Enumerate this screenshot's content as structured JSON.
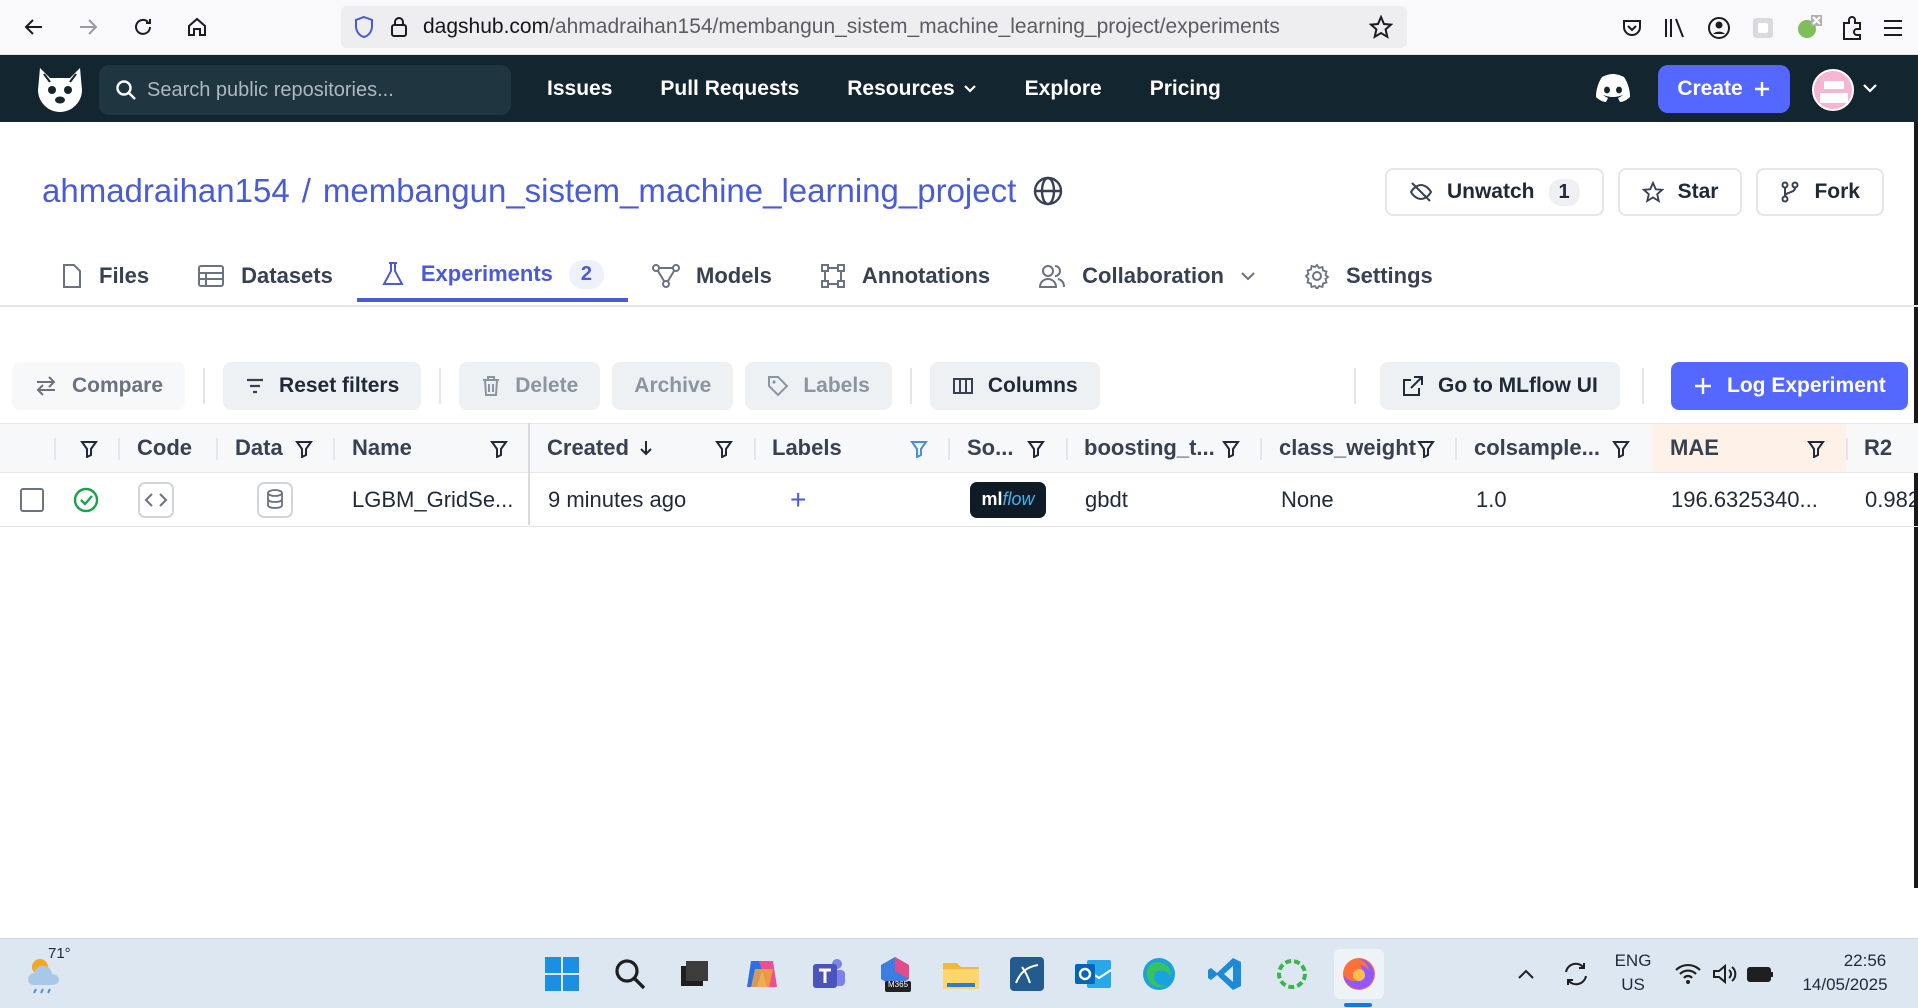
{
  "browser": {
    "url_domain": "dagshub.com",
    "url_path": "/ahmadraihan154/membangun_sistem_machine_learning_project/experiments"
  },
  "header": {
    "search_placeholder": "Search public repositories...",
    "nav": [
      "Issues",
      "Pull Requests",
      "Resources",
      "Explore",
      "Pricing"
    ],
    "create_label": "Create"
  },
  "repo": {
    "owner": "ahmadraihan154",
    "slash": "/",
    "name": "membangun_sistem_machine_learning_project",
    "unwatch_label": "Unwatch",
    "watch_count": "1",
    "star_label": "Star",
    "fork_label": "Fork"
  },
  "tabs": [
    {
      "label": "Files"
    },
    {
      "label": "Datasets"
    },
    {
      "label": "Experiments",
      "count": "2"
    },
    {
      "label": "Models"
    },
    {
      "label": "Annotations"
    },
    {
      "label": "Collaboration"
    },
    {
      "label": "Settings"
    }
  ],
  "toolbar": {
    "compare": "Compare",
    "reset_filters": "Reset filters",
    "delete": "Delete",
    "archive": "Archive",
    "labels": "Labels",
    "columns": "Columns",
    "mlflow_ui": "Go to MLflow UI",
    "log_experiment": "Log Experiment"
  },
  "table": {
    "headers": {
      "code": "Code",
      "data": "Data",
      "name": "Name",
      "created": "Created",
      "labels": "Labels",
      "source": "So...",
      "boosting": "boosting_t...",
      "class_weight": "class_weight",
      "colsample": "colsample...",
      "mae": "MAE",
      "r2": "R2"
    },
    "rows": [
      {
        "name": "LGBM_GridSe...",
        "created": "9 minutes ago",
        "labels_add": "+",
        "source_badge_a": "ml",
        "source_badge_b": "flow",
        "boosting": "gbdt",
        "class_weight": "None",
        "colsample": "1.0",
        "mae": "196.6325340...",
        "r2": "0.982"
      }
    ]
  },
  "taskbar": {
    "temperature": "71°",
    "lang_1": "ENG",
    "lang_2": "US",
    "time": "22:56",
    "date": "14/05/2025",
    "m365_label": "M365"
  },
  "colors": {
    "accent": "#5468ff",
    "link": "#4a5bd6",
    "header_bg": "#13252f",
    "success": "#16a34a"
  }
}
